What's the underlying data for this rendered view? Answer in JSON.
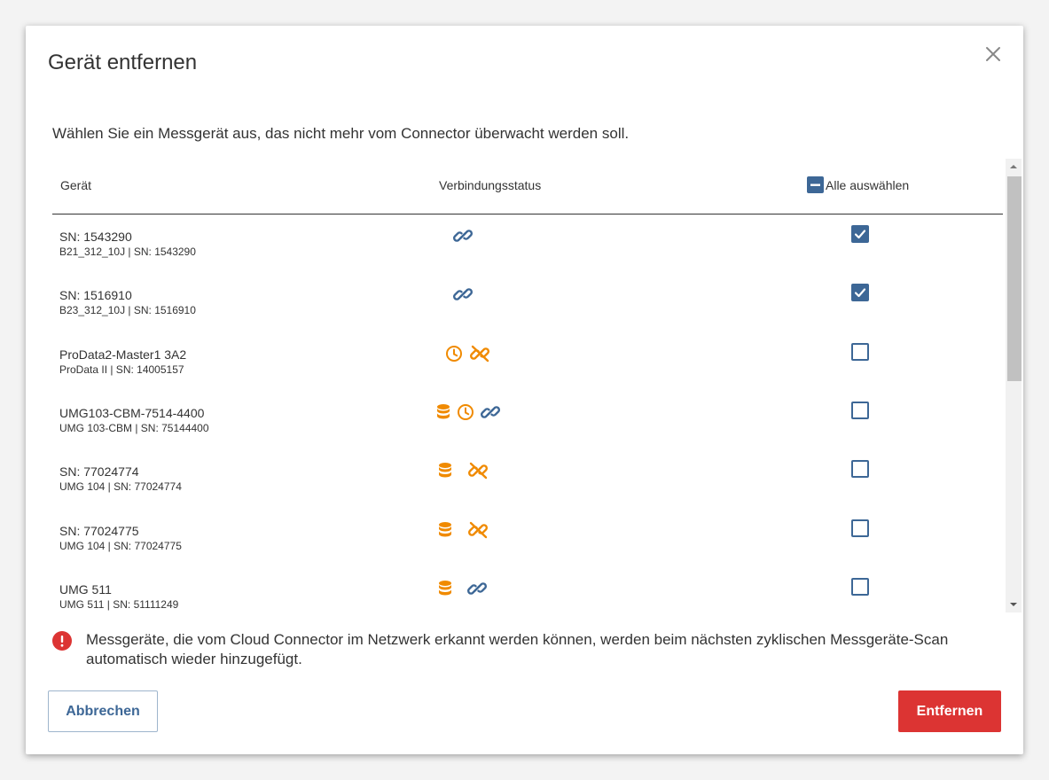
{
  "dialog": {
    "title": "Gerät entfernen",
    "intro": "Wählen Sie ein Messgerät aus, das nicht mehr vom Connector überwacht werden soll.",
    "notice": "Messgeräte, die vom Cloud Connector im Netzwerk erkannt werden können, werden beim nächsten zyklischen Messgeräte-Scan automatisch wieder hinzugefügt.",
    "cancel_label": "Abbrechen",
    "remove_label": "Entfernen"
  },
  "table": {
    "col_device": "Gerät",
    "col_status": "Verbindungsstatus",
    "select_all_label": "Alle auswählen",
    "select_all_state": "indeterminate"
  },
  "devices": [
    {
      "name": "SN: 1543290",
      "sub": "B21_312_10J | SN: 1543290",
      "status": [
        "link-blue"
      ],
      "checked": true
    },
    {
      "name": "SN: 1516910",
      "sub": "B23_312_10J | SN: 1516910",
      "status": [
        "link-blue"
      ],
      "checked": true
    },
    {
      "name": "ProData2-Master1 3A2",
      "sub": "ProData II | SN: 14005157",
      "status": [
        "clock-orange",
        "unlink-orange"
      ],
      "checked": false
    },
    {
      "name": "UMG103-CBM-7514-4400",
      "sub": "UMG 103-CBM | SN: 75144400",
      "status": [
        "database-orange",
        "clock-orange",
        "link-blue"
      ],
      "checked": false
    },
    {
      "name": "SN: 77024774",
      "sub": "UMG 104 | SN: 77024774",
      "status": [
        "database-orange",
        "unlink-orange"
      ],
      "checked": false
    },
    {
      "name": "SN: 77024775",
      "sub": "UMG 104 | SN: 77024775",
      "status": [
        "database-orange",
        "unlink-orange"
      ],
      "checked": false
    },
    {
      "name": "UMG 511",
      "sub": "UMG 511 | SN: 51111249",
      "status": [
        "database-orange",
        "link-blue"
      ],
      "checked": false
    }
  ],
  "colors": {
    "accent_blue": "#3d6796",
    "status_orange": "#f08a00",
    "danger_red": "#dc3433"
  }
}
